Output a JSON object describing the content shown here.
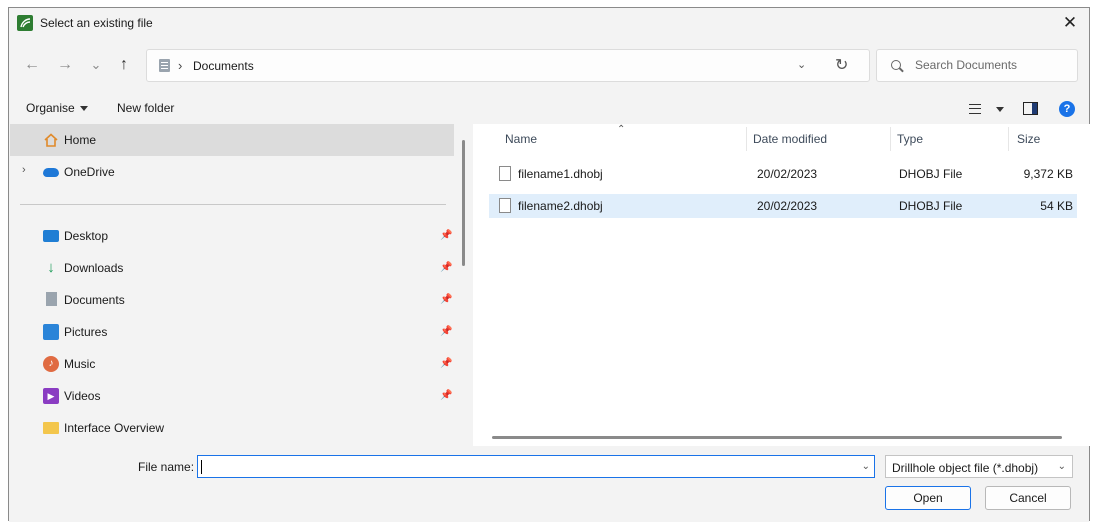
{
  "window": {
    "title": "Select an existing file",
    "close_glyph": "✕"
  },
  "nav": {
    "back_glyph": "←",
    "forward_glyph": "→",
    "recent_glyph": "⌄",
    "up_glyph": "↑",
    "address_separator": "›",
    "address_location": "Documents",
    "address_dropdown_glyph": "⌄",
    "refresh_glyph": "↻",
    "search_placeholder": "Search Documents"
  },
  "toolbar": {
    "organise_label": "Organise",
    "new_folder_label": "New folder",
    "help_glyph": "?"
  },
  "sidebar": {
    "items": [
      {
        "label": "Home",
        "icon": "home-icon"
      },
      {
        "label": "OneDrive",
        "icon": "onedrive-icon"
      },
      {
        "label": "Desktop",
        "icon": "desktop-icon",
        "pinned": true
      },
      {
        "label": "Downloads",
        "icon": "download-icon",
        "pinned": true
      },
      {
        "label": "Documents",
        "icon": "documents-icon",
        "pinned": true
      },
      {
        "label": "Pictures",
        "icon": "pictures-icon",
        "pinned": true
      },
      {
        "label": "Music",
        "icon": "music-icon",
        "pinned": true
      },
      {
        "label": "Videos",
        "icon": "videos-icon",
        "pinned": true
      },
      {
        "label": "Interface Overview",
        "icon": "folder-icon"
      }
    ],
    "expand_glyph": "›",
    "pin_glyph": "📌"
  },
  "files": {
    "columns": [
      "Name",
      "Date modified",
      "Type",
      "Size"
    ],
    "sort_glyph": "⌃",
    "rows": [
      {
        "name": "filename1.dhobj",
        "date": "20/02/2023",
        "type": "DHOBJ File",
        "size": "9,372 KB"
      },
      {
        "name": "filename2.dhobj",
        "date": "20/02/2023",
        "type": "DHOBJ File",
        "size": "54 KB"
      }
    ]
  },
  "bottom": {
    "file_name_label": "File name:",
    "file_name_value": "",
    "file_name_dropdown_glyph": "⌄",
    "filter_value": "Drillhole object file (*.dhobj)",
    "filter_dropdown_glyph": "⌄",
    "open_label": "Open",
    "cancel_label": "Cancel"
  },
  "colors": {
    "accent": "#1a73e8",
    "selection": "#e0eefb",
    "nav_selected": "#dcdcdc"
  }
}
